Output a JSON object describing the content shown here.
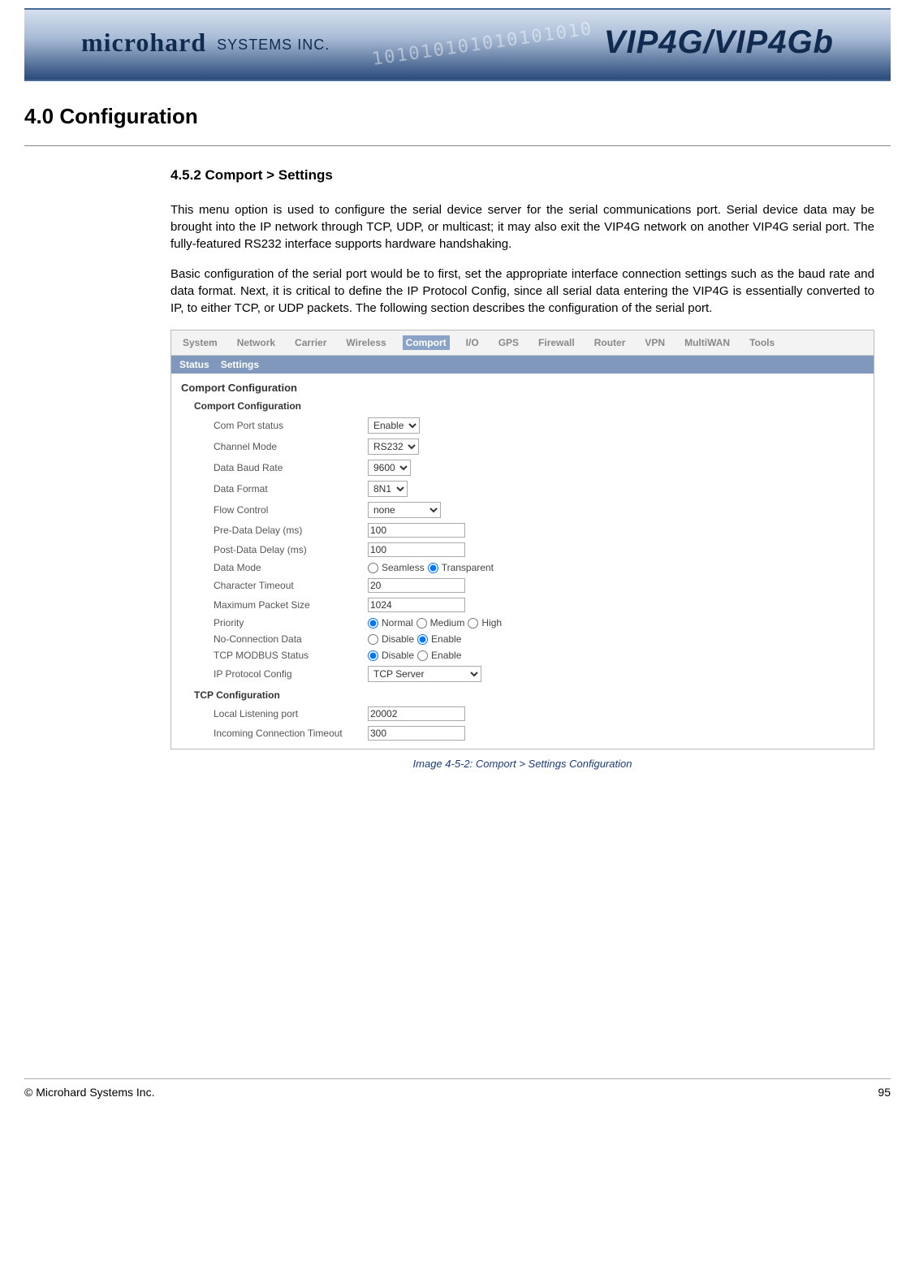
{
  "banner": {
    "brand_main": "microhard",
    "brand_sub": "SYSTEMS INC.",
    "product": "VIP4G/VIP4Gb",
    "bits": "101010101010101010"
  },
  "main_heading": "4.0   Configuration",
  "sub_heading": "4.5.2 Comport > Settings",
  "para1": "This menu option is used to configure the serial device server for the serial communications port. Serial device data may be brought into the IP network through TCP, UDP, or multicast; it may also exit the VIP4G network on another VIP4G serial port. The fully-featured RS232 interface supports hardware handshaking.",
  "para2": "Basic configuration of the serial port would be to first, set the appropriate interface connection settings such as the baud rate and data format. Next, it is critical to define the IP Protocol Config, since all serial data entering the VIP4G is essentially converted to IP, to either TCP, or UDP packets. The following section describes the configuration of the serial port.",
  "ui": {
    "topnav": [
      "System",
      "Network",
      "Carrier",
      "Wireless",
      "Comport",
      "I/O",
      "GPS",
      "Firewall",
      "Router",
      "VPN",
      "MultiWAN",
      "Tools"
    ],
    "topnav_active": "Comport",
    "subnav": [
      "Status",
      "Settings"
    ],
    "section_title": "Comport Configuration",
    "group1_title": "Comport Configuration",
    "fields": {
      "com_port_status": {
        "label": "Com Port status",
        "value": "Enable"
      },
      "channel_mode": {
        "label": "Channel Mode",
        "value": "RS232"
      },
      "baud_rate": {
        "label": "Data Baud Rate",
        "value": "9600"
      },
      "data_format": {
        "label": "Data Format",
        "value": "8N1"
      },
      "flow_control": {
        "label": "Flow Control",
        "value": "none"
      },
      "pre_delay": {
        "label": "Pre-Data Delay (ms)",
        "value": "100"
      },
      "post_delay": {
        "label": "Post-Data Delay (ms)",
        "value": "100"
      },
      "data_mode": {
        "label": "Data Mode",
        "opt1": "Seamless",
        "opt2": "Transparent",
        "selected": "Transparent"
      },
      "char_timeout": {
        "label": "Character Timeout",
        "value": "20"
      },
      "max_packet": {
        "label": "Maximum Packet Size",
        "value": "1024"
      },
      "priority": {
        "label": "Priority",
        "opt1": "Normal",
        "opt2": "Medium",
        "opt3": "High",
        "selected": "Normal"
      },
      "no_conn": {
        "label": "No-Connection Data",
        "opt1": "Disable",
        "opt2": "Enable",
        "selected": "Enable"
      },
      "modbus": {
        "label": "TCP MODBUS Status",
        "opt1": "Disable",
        "opt2": "Enable",
        "selected": "Disable"
      },
      "ip_proto": {
        "label": "IP Protocol Config",
        "value": "TCP Server"
      }
    },
    "group2_title": "TCP Configuration",
    "tcp": {
      "listen_port": {
        "label": "Local Listening port",
        "value": "20002"
      },
      "inc_timeout": {
        "label": "Incoming Connection Timeout",
        "value": "300"
      }
    }
  },
  "caption": "Image 4-5-2:  Comport  >  Settings Configuration",
  "footer": {
    "left": "© Microhard Systems Inc.",
    "right": "95"
  }
}
